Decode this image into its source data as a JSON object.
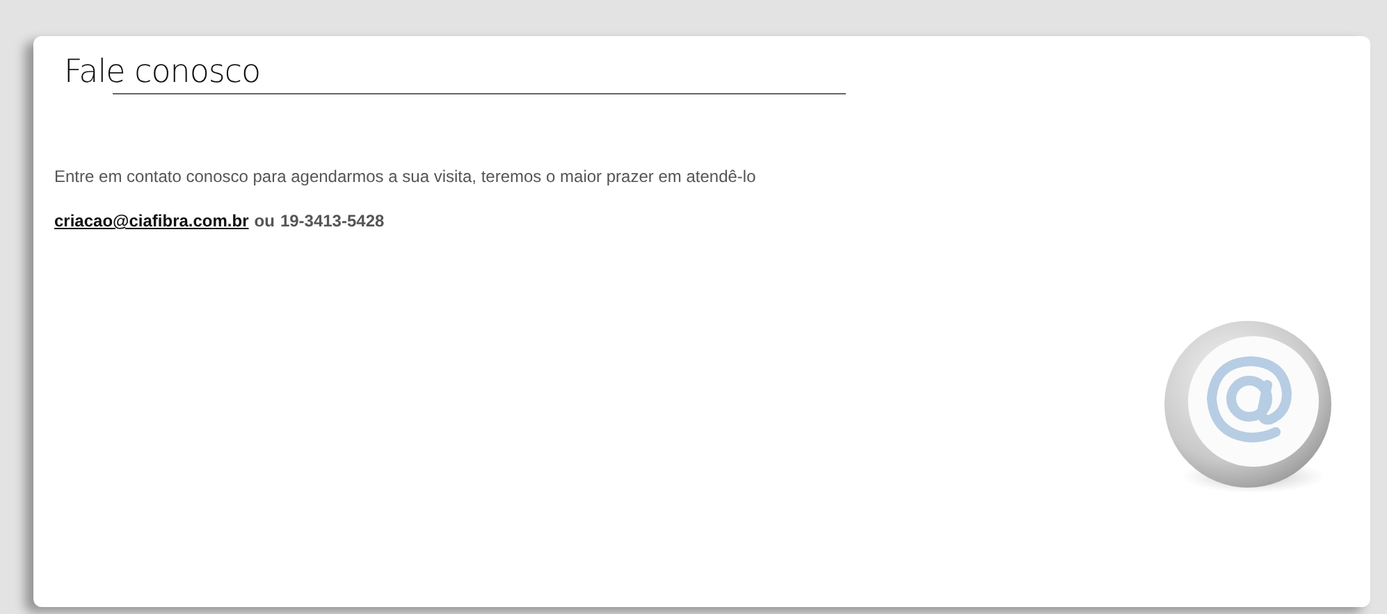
{
  "heading": "Fale conosco",
  "intro": "Entre em contato conosco para agendarmos a sua visita, teremos o maior prazer em atendê-lo",
  "contact": {
    "email": "criacao@ciafibra.com.br",
    "separator": "ou",
    "phone": "19-3413-5428"
  }
}
